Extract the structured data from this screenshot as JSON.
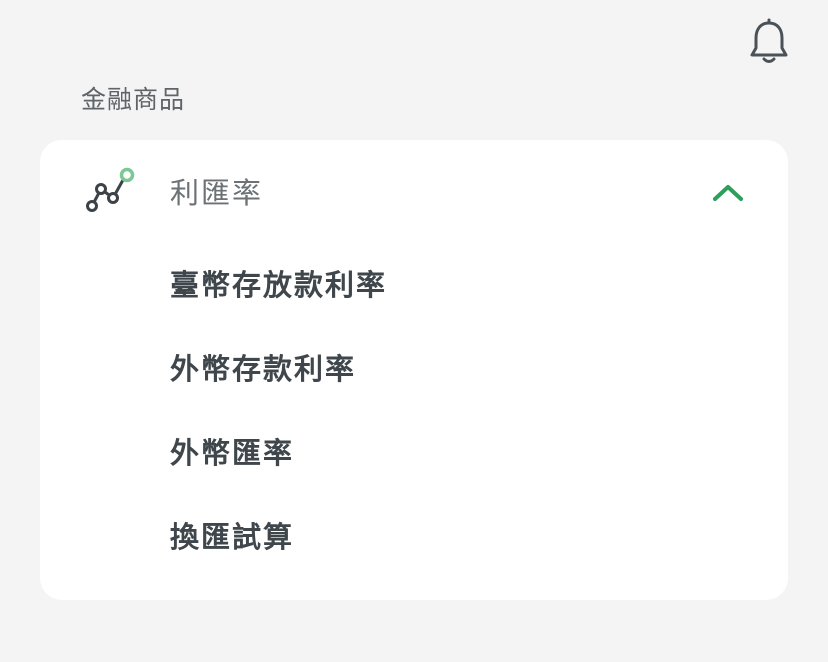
{
  "header": {
    "notification_icon": "bell-icon"
  },
  "section": {
    "title": "金融商品"
  },
  "accordion": {
    "label": "利匯率",
    "icon": "rate-chart-icon",
    "expanded": true,
    "toggle_icon": "chevron-up-icon",
    "accent_color": "#2e9e5b",
    "items": [
      {
        "label": "臺幣存放款利率"
      },
      {
        "label": "外幣存款利率"
      },
      {
        "label": "外幣匯率"
      },
      {
        "label": "換匯試算"
      }
    ]
  }
}
